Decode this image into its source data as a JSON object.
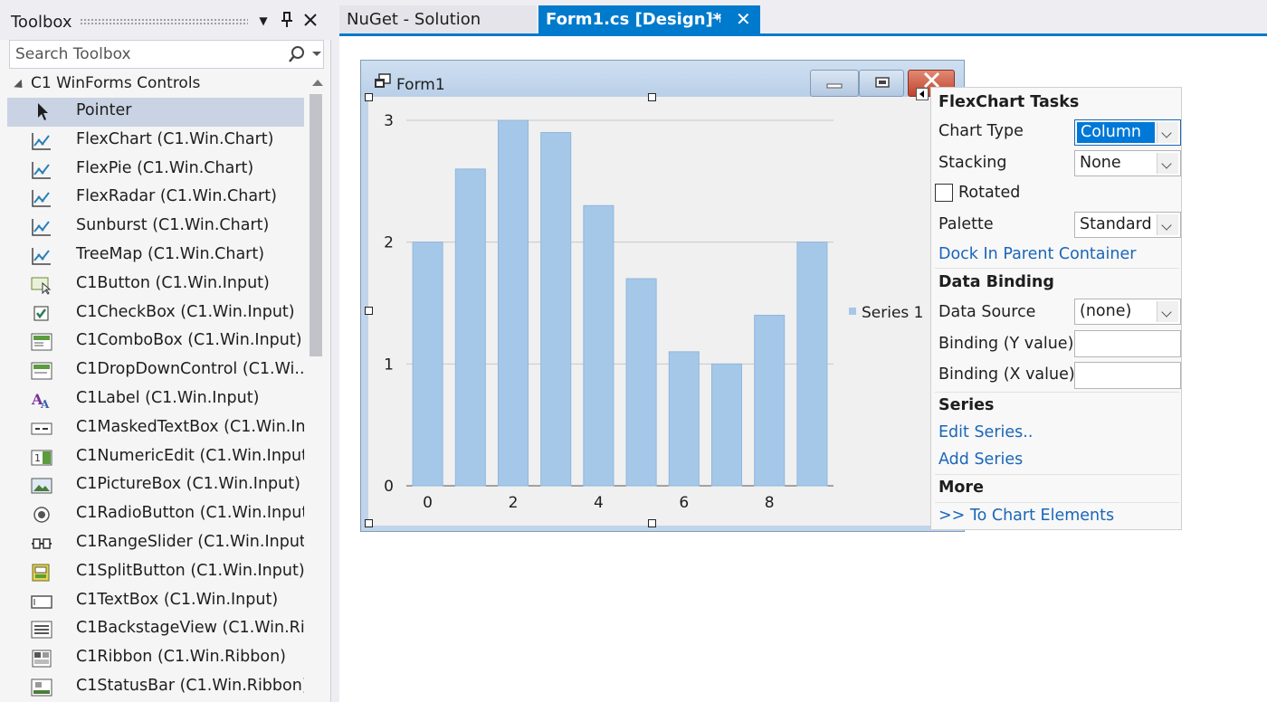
{
  "toolbox": {
    "title": "Toolbox",
    "search_placeholder": "Search Toolbox",
    "category": "C1 WinForms Controls",
    "items": [
      {
        "label": "Pointer",
        "icon": "pointer-icon",
        "selected": true
      },
      {
        "label": "FlexChart (C1.Win.Chart)",
        "icon": "chart-icon"
      },
      {
        "label": "FlexPie (C1.Win.Chart)",
        "icon": "chart-icon"
      },
      {
        "label": "FlexRadar (C1.Win.Chart)",
        "icon": "chart-icon"
      },
      {
        "label": "Sunburst (C1.Win.Chart)",
        "icon": "chart-icon"
      },
      {
        "label": "TreeMap (C1.Win.Chart)",
        "icon": "chart-icon"
      },
      {
        "label": "C1Button (C1.Win.Input)",
        "icon": "button-icon"
      },
      {
        "label": "C1CheckBox (C1.Win.Input)",
        "icon": "checkbox-icon"
      },
      {
        "label": "C1ComboBox (C1.Win.Input)",
        "icon": "combobox-icon"
      },
      {
        "label": "C1DropDownControl (C1.Wi...",
        "icon": "dropdown-icon"
      },
      {
        "label": "C1Label (C1.Win.Input)",
        "icon": "label-icon"
      },
      {
        "label": "C1MaskedTextBox (C1.Win.In...",
        "icon": "maskedtextbox-icon"
      },
      {
        "label": "C1NumericEdit (C1.Win.Input)",
        "icon": "numericedit-icon"
      },
      {
        "label": "C1PictureBox (C1.Win.Input)",
        "icon": "picturebox-icon"
      },
      {
        "label": "C1RadioButton (C1.Win.Input)",
        "icon": "radiobutton-icon"
      },
      {
        "label": "C1RangeSlider (C1.Win.Input)",
        "icon": "rangeslider-icon"
      },
      {
        "label": "C1SplitButton (C1.Win.Input)",
        "icon": "splitbutton-icon"
      },
      {
        "label": "C1TextBox (C1.Win.Input)",
        "icon": "textbox-icon"
      },
      {
        "label": "C1BackstageView (C1.Win.Ri...",
        "icon": "backstageview-icon"
      },
      {
        "label": "C1Ribbon (C1.Win.Ribbon)",
        "icon": "ribbon-icon"
      },
      {
        "label": "C1StatusBar (C1.Win.Ribbon)",
        "icon": "statusbar-icon"
      }
    ]
  },
  "tabs": {
    "nuget": "NuGet - Solution",
    "form1": "Form1.cs [Design]*"
  },
  "form": {
    "title": "Form1"
  },
  "chart_data": {
    "type": "bar",
    "x": [
      0,
      1,
      2,
      3,
      4,
      5,
      6,
      7,
      8,
      9
    ],
    "series": [
      {
        "name": "Series 1",
        "values": [
          2.0,
          2.6,
          3.0,
          2.9,
          2.3,
          1.7,
          1.1,
          1.0,
          1.4,
          2.0
        ]
      }
    ],
    "x_ticks": [
      "0",
      "2",
      "4",
      "6",
      "8"
    ],
    "y_ticks": [
      "0",
      "1",
      "2",
      "3"
    ],
    "ylim": [
      0,
      3
    ],
    "grid": "horizontal",
    "legend": "right",
    "color": "#a6c8e8"
  },
  "tasks": {
    "title": "FlexChart Tasks",
    "chart_type_label": "Chart Type",
    "chart_type_value": "Column",
    "stacking_label": "Stacking",
    "stacking_value": "None",
    "rotated_label": "Rotated",
    "palette_label": "Palette",
    "palette_value": "Standard",
    "dock_link": "Dock In Parent Container",
    "data_binding_head": "Data Binding",
    "data_source_label": "Data Source",
    "data_source_value": "(none)",
    "binding_y_label": "Binding (Y value)",
    "binding_x_label": "Binding (X value)",
    "series_head": "Series",
    "edit_series_link": "Edit Series..",
    "add_series_link": "Add Series",
    "more_head": "More",
    "chart_elements_link": ">> To Chart Elements"
  }
}
